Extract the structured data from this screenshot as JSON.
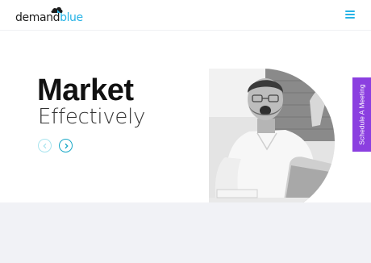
{
  "header": {
    "logo": {
      "part1": "demand",
      "part2": "blue"
    }
  },
  "hero": {
    "title": "Market",
    "subtitle": "Effectively"
  },
  "schedule_tab": {
    "label": "Schedule A Meeting"
  },
  "colors": {
    "brand_blue": "#27b3e6",
    "accent_purple": "#8b3fe0",
    "lower_band": "#f1f2f6"
  },
  "icons": {
    "menu": "hamburger-icon",
    "prev": "chevron-left-icon",
    "next": "chevron-right-icon"
  }
}
